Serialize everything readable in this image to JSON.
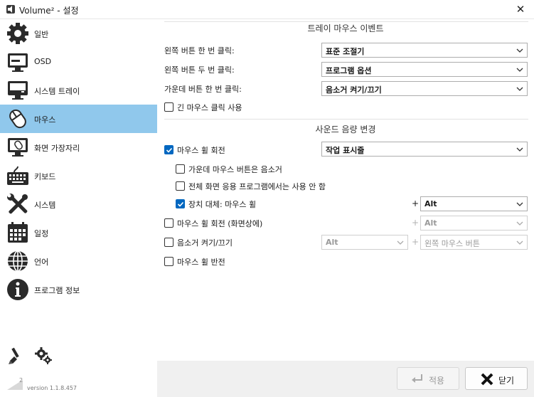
{
  "window": {
    "title": "Volume² - 설정"
  },
  "sidebar": {
    "items": [
      {
        "label": "일반",
        "icon": "gear-icon"
      },
      {
        "label": "OSD",
        "icon": "monitor-icon"
      },
      {
        "label": "시스템 트레이",
        "icon": "system-tray-icon"
      },
      {
        "label": "마우스",
        "icon": "mouse-icon",
        "selected": true
      },
      {
        "label": "화면 가장자리",
        "icon": "screen-edge-icon"
      },
      {
        "label": "키보드",
        "icon": "keyboard-icon"
      },
      {
        "label": "시스템",
        "icon": "tools-icon"
      },
      {
        "label": "일정",
        "icon": "calendar-icon"
      },
      {
        "label": "언어",
        "icon": "globe-icon"
      },
      {
        "label": "프로그램 정보",
        "icon": "info-icon"
      }
    ],
    "version_sup": "2",
    "version": "version 1.1.8.457"
  },
  "tray_section": {
    "title": "트레이 마우스 이벤트",
    "single_click_label": "왼쪽 버튼 한 번 클릭:",
    "single_click_value": "표준 조절기",
    "double_click_label": "왼쪽 버튼 두 번 클릭:",
    "double_click_value": "프로그램 옵션",
    "middle_click_label": "가운데 버튼 한 번 클릭:",
    "middle_click_value": "음소거 켜기/끄기",
    "long_click_label": "긴 마우스 클릭 사용"
  },
  "volume_section": {
    "title": "사운드 음량 변경",
    "wheel_label": "마우스 휠 회전",
    "wheel_value": "작업 표시줄",
    "middle_mute_label": "가운데 마우스 버튼은 음소거",
    "fullscreen_label": "전체 화면 응용 프로그램에서는 사용 안 함",
    "device_label": "장치 대체: 마우스 휠",
    "device_modifier": "Alt",
    "wheel_onscreen_label": "마우스 휠 회전 (화면상에)",
    "wheel_onscreen_modifier": "Alt",
    "mute_toggle_label": "음소거 켜기/끄기",
    "mute_modifier": "Alt",
    "mute_button": "왼쪽 마우스 버튼",
    "invert_label": "마우스 휠 반전",
    "plus": "+"
  },
  "footer": {
    "apply_label": "적용",
    "close_label": "닫기"
  },
  "colors": {
    "selected": "#90c8ec",
    "accent": "#0067c0"
  }
}
